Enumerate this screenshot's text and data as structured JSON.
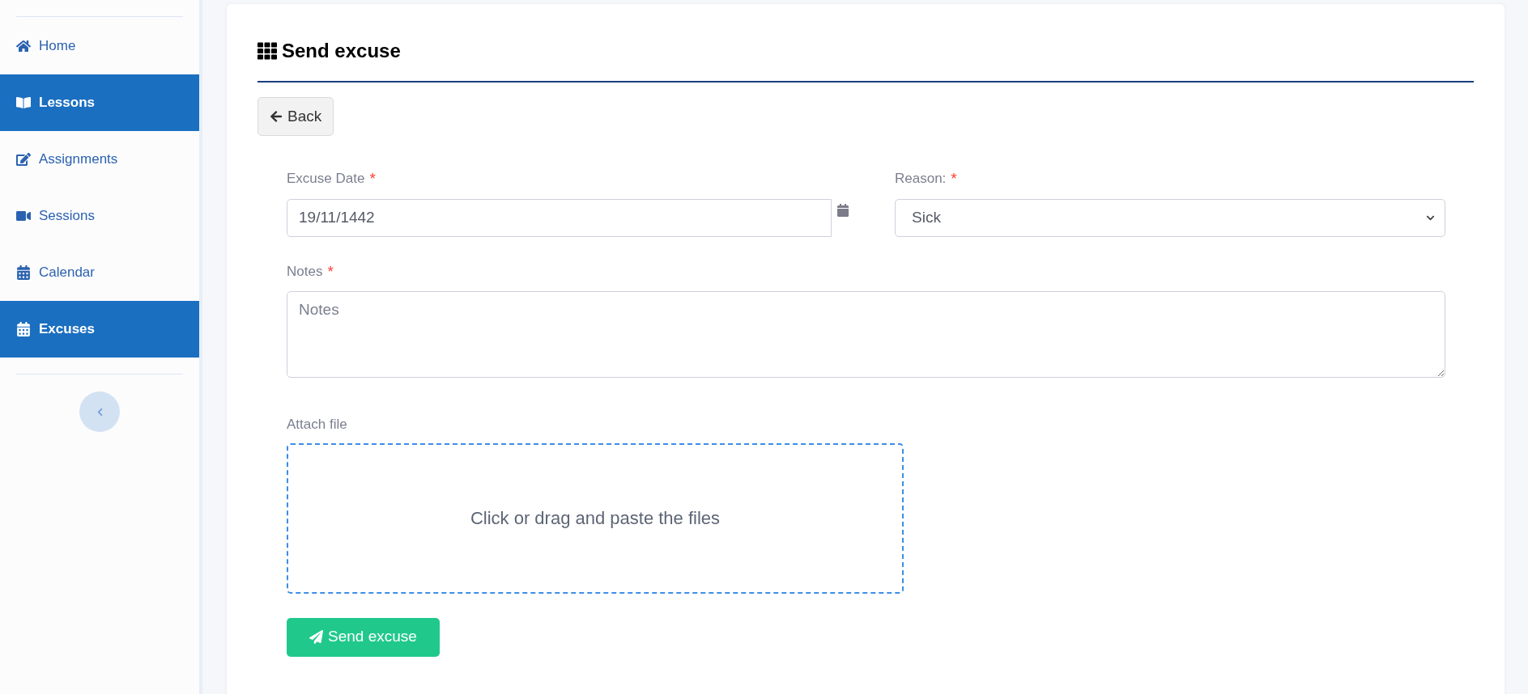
{
  "sidebar": {
    "items": [
      {
        "label": "Home",
        "selected": false
      },
      {
        "label": "Lessons",
        "selected": true
      },
      {
        "label": "Assignments",
        "selected": false
      },
      {
        "label": "Sessions",
        "selected": false
      },
      {
        "label": "Calendar",
        "selected": false
      },
      {
        "label": "Excuses",
        "selected": true
      }
    ]
  },
  "page": {
    "title": "Send excuse",
    "back_button": "Back"
  },
  "form": {
    "excuse_date": {
      "label": "Excuse Date",
      "required_mark": "*",
      "value": "19/11/1442"
    },
    "reason": {
      "label": "Reason:",
      "required_mark": "*",
      "value": "Sick"
    },
    "notes": {
      "label": "Notes",
      "required_mark": "*",
      "placeholder": "Notes"
    },
    "attach_file": {
      "label": "Attach file",
      "hint": "Click or drag and paste the files"
    },
    "submit_button": "Send excuse"
  }
}
